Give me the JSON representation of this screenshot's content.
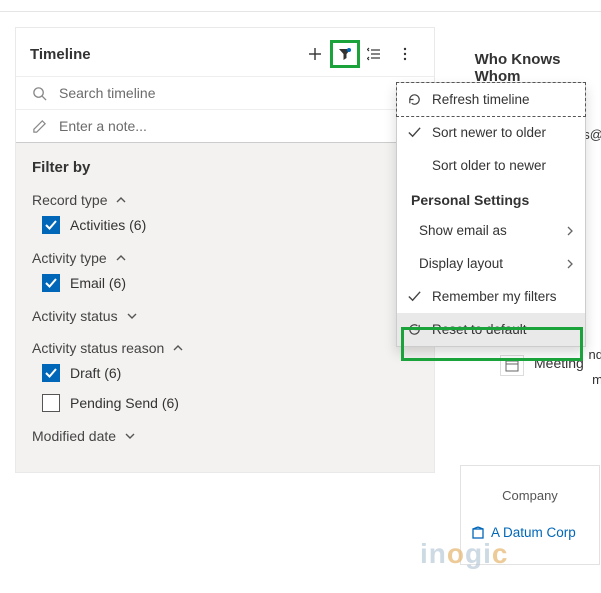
{
  "timeline": {
    "title": "Timeline",
    "search_placeholder": "Search timeline",
    "note_placeholder": "Enter a note..."
  },
  "filter": {
    "heading": "Filter by",
    "record_type_label": "Record type",
    "record_type_item": "Activities (6)",
    "activity_type_label": "Activity type",
    "activity_type_item": "Email (6)",
    "activity_status_label": "Activity status",
    "activity_status_reason_label": "Activity status reason",
    "status_reason_draft": "Draft (6)",
    "status_reason_pending": "Pending Send (6)",
    "modified_date_label": "Modified date"
  },
  "menu": {
    "refresh": "Refresh timeline",
    "sort_newer": "Sort newer to older",
    "sort_older": "Sort older to newer",
    "personal_heading": "Personal Settings",
    "show_email": "Show email as",
    "display_layout": "Display layout",
    "remember_filters": "Remember my filters",
    "reset": "Reset to default"
  },
  "right": {
    "who_knows": "Who Knows Whom",
    "frag_es": "es@",
    "frag_nd": "nd",
    "frag_m": "m",
    "meeting": "Meeting",
    "company_label": "Company",
    "company_name": "A Datum Corp"
  },
  "watermark": "inogic"
}
